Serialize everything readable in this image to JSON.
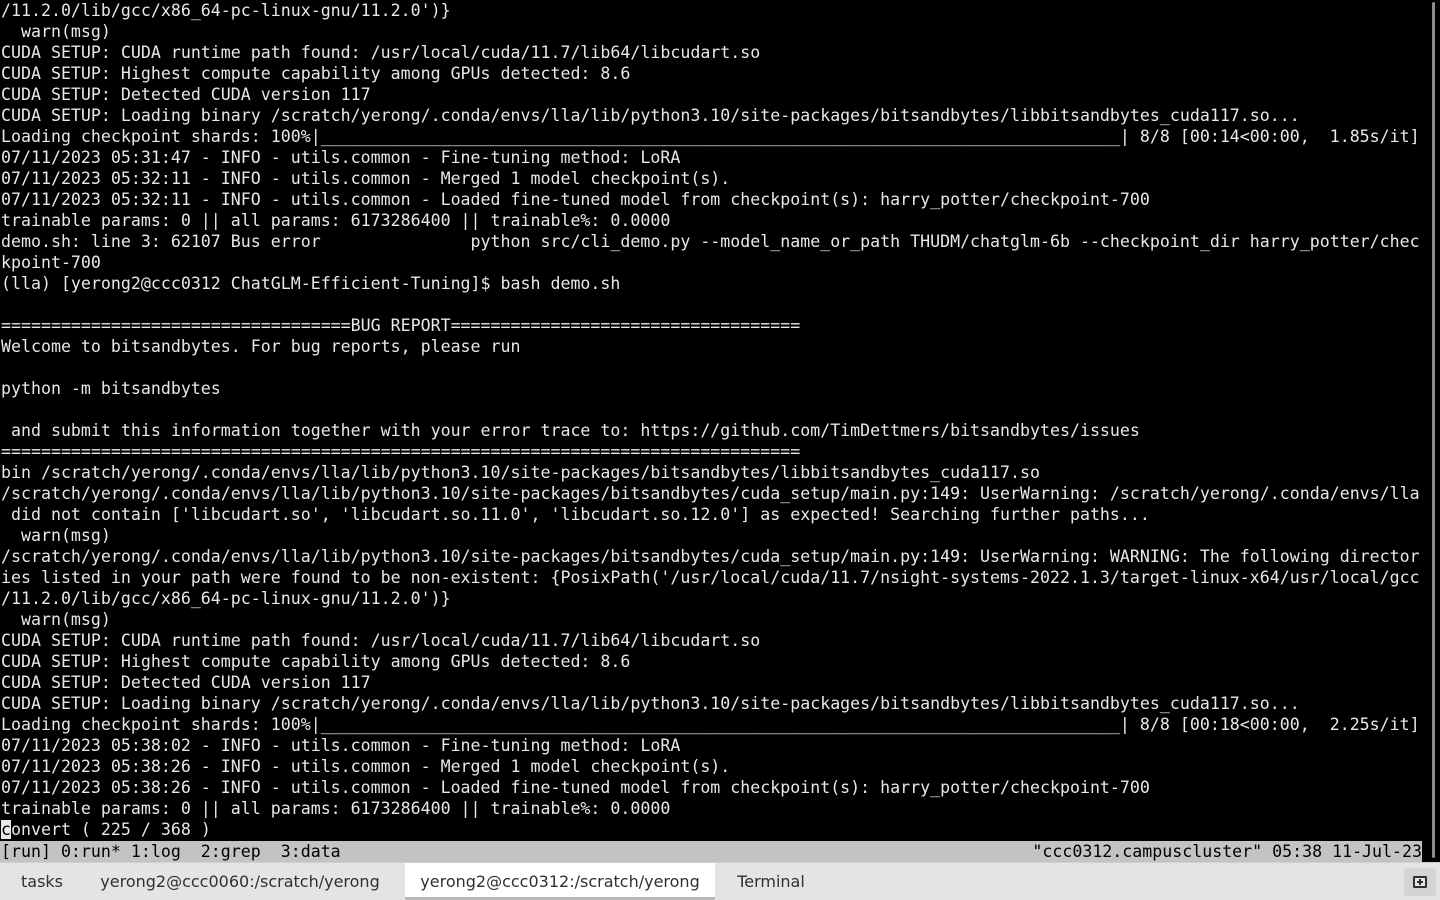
{
  "terminal": {
    "lines": [
      "/11.2.0/lib/gcc/x86_64-pc-linux-gnu/11.2.0')}",
      "  warn(msg)",
      "CUDA SETUP: CUDA runtime path found: /usr/local/cuda/11.7/lib64/libcudart.so",
      "CUDA SETUP: Highest compute capability among GPUs detected: 8.6",
      "CUDA SETUP: Detected CUDA version 117",
      "CUDA SETUP: Loading binary /scratch/yerong/.conda/envs/lla/lib/python3.10/site-packages/bitsandbytes/libbitsandbytes_cuda117.so...",
      "Loading checkpoint shards: 100%|________________________________________________________________________________| 8/8 [00:14<00:00,  1.85s/it]",
      "07/11/2023 05:31:47 - INFO - utils.common - Fine-tuning method: LoRA",
      "07/11/2023 05:32:11 - INFO - utils.common - Merged 1 model checkpoint(s).",
      "07/11/2023 05:32:11 - INFO - utils.common - Loaded fine-tuned model from checkpoint(s): harry_potter/checkpoint-700",
      "trainable params: 0 || all params: 6173286400 || trainable%: 0.0000",
      "demo.sh: line 3: 62107 Bus error               python src/cli_demo.py --model_name_or_path THUDM/chatglm-6b --checkpoint_dir harry_potter/chec",
      "kpoint-700",
      "(lla) [yerong2@ccc0312 ChatGLM-Efficient-Tuning]$ bash demo.sh",
      "",
      "===================================BUG REPORT===================================",
      "Welcome to bitsandbytes. For bug reports, please run",
      "",
      "python -m bitsandbytes",
      "",
      " and submit this information together with your error trace to: https://github.com/TimDettmers/bitsandbytes/issues",
      "================================================================================",
      "bin /scratch/yerong/.conda/envs/lla/lib/python3.10/site-packages/bitsandbytes/libbitsandbytes_cuda117.so",
      "/scratch/yerong/.conda/envs/lla/lib/python3.10/site-packages/bitsandbytes/cuda_setup/main.py:149: UserWarning: /scratch/yerong/.conda/envs/lla",
      " did not contain ['libcudart.so', 'libcudart.so.11.0', 'libcudart.so.12.0'] as expected! Searching further paths...",
      "  warn(msg)",
      "/scratch/yerong/.conda/envs/lla/lib/python3.10/site-packages/bitsandbytes/cuda_setup/main.py:149: UserWarning: WARNING: The following director",
      "ies listed in your path were found to be non-existent: {PosixPath('/usr/local/cuda/11.7/nsight-systems-2022.1.3/target-linux-x64/usr/local/gcc",
      "/11.2.0/lib/gcc/x86_64-pc-linux-gnu/11.2.0')}",
      "  warn(msg)",
      "CUDA SETUP: CUDA runtime path found: /usr/local/cuda/11.7/lib64/libcudart.so",
      "CUDA SETUP: Highest compute capability among GPUs detected: 8.6",
      "CUDA SETUP: Detected CUDA version 117",
      "CUDA SETUP: Loading binary /scratch/yerong/.conda/envs/lla/lib/python3.10/site-packages/bitsandbytes/libbitsandbytes_cuda117.so...",
      "Loading checkpoint shards: 100%|________________________________________________________________________________| 8/8 [00:18<00:00,  2.25s/it]",
      "07/11/2023 05:38:02 - INFO - utils.common - Fine-tuning method: LoRA",
      "07/11/2023 05:38:26 - INFO - utils.common - Merged 1 model checkpoint(s).",
      "07/11/2023 05:38:26 - INFO - utils.common - Loaded fine-tuned model from checkpoint(s): harry_potter/checkpoint-700",
      "trainable params: 0 || all params: 6173286400 || trainable%: 0.0000"
    ],
    "prompt_line": {
      "cursor_char": "c",
      "rest": "onvert ( 225 / 368 )"
    }
  },
  "status_bar": {
    "left": "[run] 0:run* 1:log  2:grep  3:data",
    "right": "\"ccc0312.campuscluster\" 05:38 11-Jul-23"
  },
  "tabs": [
    {
      "label": "tasks",
      "active": false
    },
    {
      "label": "yerong2@ccc0060:/scratch/yerong",
      "active": false
    },
    {
      "label": "yerong2@ccc0312:/scratch/yerong",
      "active": true
    },
    {
      "label": "Terminal",
      "active": false
    }
  ],
  "icons": {
    "new_tab": "new-terminal-tab-icon"
  },
  "colors": {
    "terminal_bg": "#000000",
    "terminal_fg": "#e8e8e8",
    "status_bar_bg": "#c3c3c3",
    "tab_bar_bg": "#e4e4e4",
    "active_tab_bg": "#ffffff"
  }
}
